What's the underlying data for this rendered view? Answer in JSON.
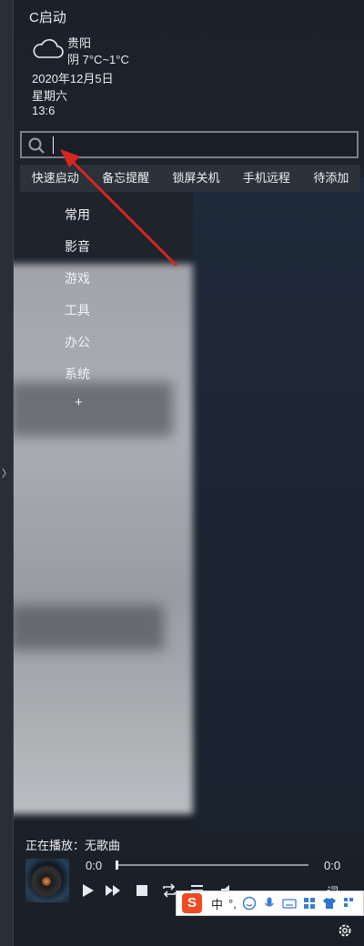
{
  "app": {
    "title": "C启动"
  },
  "weather": {
    "icon": "cloud-icon",
    "city": "贵阳",
    "condition_line": "阴  7°C~1°C"
  },
  "datetime": {
    "date": "2020年12月5日",
    "weekday": "星期六",
    "time": "13:6"
  },
  "search": {
    "placeholder": "",
    "value": ""
  },
  "tabs": [
    {
      "label": "快速启动"
    },
    {
      "label": "备忘提醒"
    },
    {
      "label": "锁屏关机"
    },
    {
      "label": "手机远程"
    },
    {
      "label": "待添加"
    }
  ],
  "categories": [
    {
      "label": "常用"
    },
    {
      "label": "影音"
    },
    {
      "label": "游戏"
    },
    {
      "label": "工具"
    },
    {
      "label": "办公"
    },
    {
      "label": "系统"
    }
  ],
  "add_label": "+",
  "player": {
    "now_playing": "正在播放：无歌曲",
    "time_start": "0:0",
    "time_end": "0:0",
    "lyric_label": "词",
    "progress": 0
  },
  "ime": {
    "logo": "S",
    "mode": "中",
    "punct": "°,"
  },
  "colors": {
    "accent_arrow": "#d7261e",
    "ime_logo": "#ef4b23",
    "background": "#1c2129"
  }
}
